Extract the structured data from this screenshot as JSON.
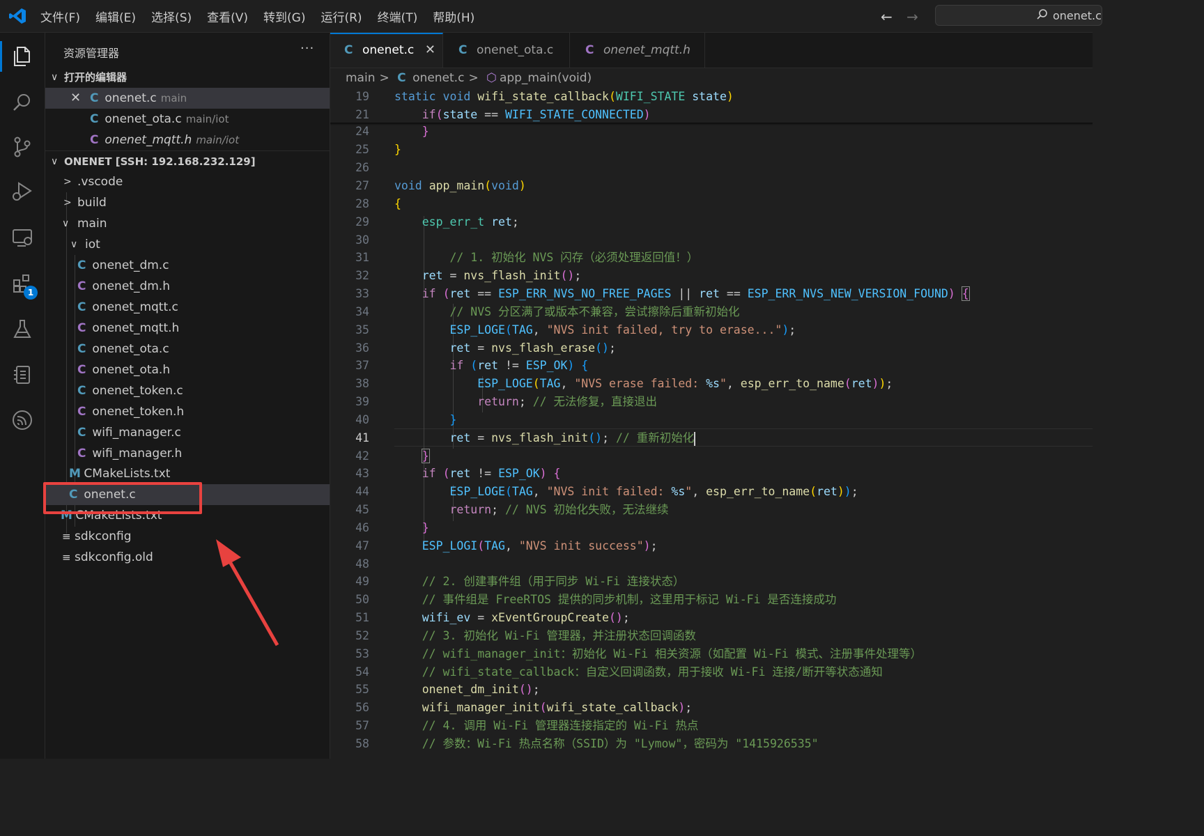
{
  "menu": [
    "文件(F)",
    "编辑(E)",
    "选择(S)",
    "查看(V)",
    "转到(G)",
    "运行(R)",
    "终端(T)",
    "帮助(H)"
  ],
  "nav": {
    "back": "←",
    "forward": "→"
  },
  "command_center": {
    "text": "onenet.c"
  },
  "activity": {
    "extensions_badge": "1"
  },
  "sidebar": {
    "title": "资源管理器",
    "more": "···",
    "open_editors": {
      "header": "打开的编辑器",
      "items": [
        {
          "name": "onenet.c",
          "desc": "main"
        },
        {
          "name": "onenet_ota.c",
          "desc": "main/iot"
        },
        {
          "name": "onenet_mqtt.h",
          "desc": "main/iot"
        }
      ]
    },
    "workspace": {
      "header": "ONENET [SSH: 192.168.232.129]",
      "folders": [
        ".vscode",
        "build",
        "main",
        "iot"
      ],
      "iot_files": [
        "onenet_dm.c",
        "onenet_dm.h",
        "onenet_mqtt.c",
        "onenet_mqtt.h",
        "onenet_ota.c",
        "onenet_ota.h",
        "onenet_token.c",
        "onenet_token.h",
        "wifi_manager.c",
        "wifi_manager.h"
      ],
      "main_files": [
        "CMakeLists.txt",
        "onenet.c"
      ],
      "root_files": [
        "CMakeLists.txt",
        "sdkconfig",
        "sdkconfig.old"
      ]
    }
  },
  "tabs": [
    {
      "label": "onenet.c",
      "close": "✕"
    },
    {
      "label": "onenet_ota.c"
    },
    {
      "label": "onenet_mqtt.h"
    }
  ],
  "breadcrumb": {
    "folder": "main",
    "file": "onenet.c",
    "symbol": "app_main(void)"
  },
  "editor": {
    "line_numbers": [
      "19",
      "21",
      "24",
      "25",
      "26",
      "27",
      "28",
      "29",
      "30",
      "31",
      "32",
      "33",
      "34",
      "35",
      "36",
      "37",
      "38",
      "39",
      "40",
      "41",
      "42",
      "43",
      "44",
      "45",
      "46",
      "47",
      "48",
      "49",
      "50",
      "51",
      "52",
      "53",
      "54",
      "55",
      "56",
      "57",
      "58"
    ],
    "current_line": "41",
    "code": {
      "t_static": "static",
      "t_void": "void",
      "t_cb": "wifi_state_callback",
      "t_wstate": "WIFI_STATE",
      "t_state": "state",
      "t_if": "if",
      "t_eq": " == ",
      "t_connected": "WIFI_STATE_CONNECTED",
      "t_app_main": "app_main",
      "t_esp_err_t": "esp_err_t",
      "t_ret": "ret",
      "c31": "// 1. 初始化 NVS 闪存（必须处理返回值！）",
      "t_nvs_init": "nvs_flash_init",
      "t_no_free": "ESP_ERR_NVS_NO_FREE_PAGES",
      "t_or": " || ",
      "t_new_ver": "ESP_ERR_NVS_NEW_VERSION_FOUND",
      "c34": "// NVS 分区满了或版本不兼容，尝试擦除后重新初始化",
      "t_loge": "ESP_LOGE",
      "t_logi": "ESP_LOGI",
      "t_tag": "TAG",
      "s35": "\"NVS init failed, try to erase...\"",
      "t_nvs_erase": "nvs_flash_erase",
      "t_ne": " != ",
      "t_esp_ok": "ESP_OK",
      "s38a": "\"NVS erase failed: ",
      "s_fmt": "%s",
      "s_q": "\"",
      "t_err_name": "esp_err_to_name",
      "t_return": "return",
      "c39": "// 无法修复，直接退出",
      "c41": "// 重新初始化",
      "s44a": "\"NVS init failed: ",
      "c45": "// NVS 初始化失败，无法继续",
      "s47": "\"NVS init success\"",
      "c49": "// 2. 创建事件组（用于同步 Wi-Fi 连接状态）",
      "c50": "// 事件组是 FreeRTOS 提供的同步机制，这里用于标记 Wi-Fi 是否连接成功",
      "t_wifi_ev": "wifi_ev",
      "t_xevent": "xEventGroupCreate",
      "c52": "// 3. 初始化 Wi-Fi 管理器，并注册状态回调函数",
      "c53": "// wifi_manager_init：初始化 Wi-Fi 相关资源（如配置 Wi-Fi 模式、注册事件处理等）",
      "c54": "// wifi_state_callback：自定义回调函数，用于接收 Wi-Fi 连接/断开等状态通知",
      "t_dm_init": "onenet_dm_init",
      "t_wm_init": "wifi_manager_init",
      "c57": "// 4. 调用 Wi-Fi 管理器连接指定的 Wi-Fi 热点",
      "c58": "// 参数：Wi-Fi 热点名称（SSID）为 \"Lymow\"，密码为 \"1415926535\""
    }
  },
  "colors": {
    "accent": "#0078d4",
    "annotation": "#e8423f"
  }
}
